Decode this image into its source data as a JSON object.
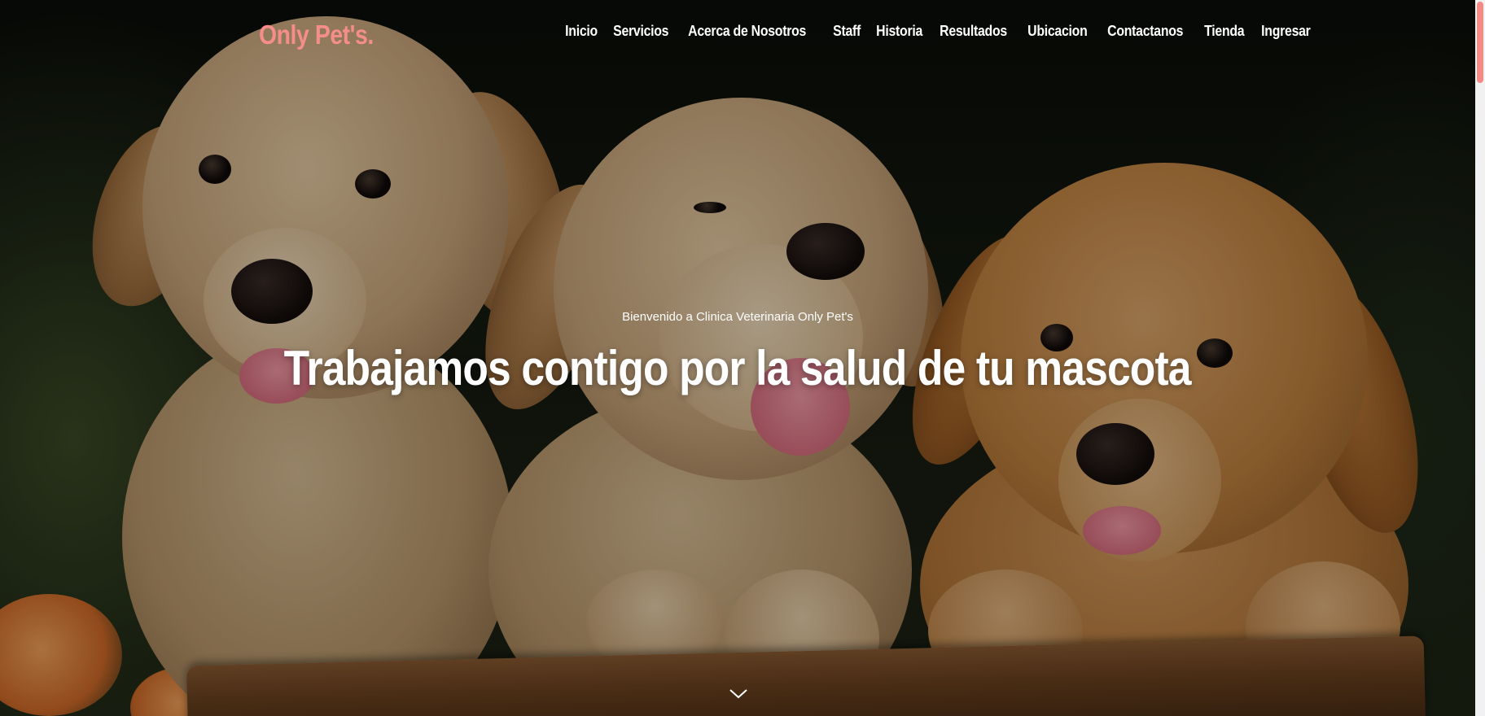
{
  "header": {
    "brand": "Only Pet's.",
    "nav": [
      {
        "label": "Inicio"
      },
      {
        "label": "Servicios"
      },
      {
        "label": "Acerca de Nosotros"
      },
      {
        "label": "Staff"
      },
      {
        "label": "Historia"
      },
      {
        "label": "Resultados"
      },
      {
        "label": "Ubicacion"
      },
      {
        "label": "Contactanos"
      },
      {
        "label": "Tienda"
      },
      {
        "label": "Ingresar"
      }
    ]
  },
  "hero": {
    "welcome": "Bienvenido a Clinica Veterinaria Only Pet's",
    "headline": "Trabajamos contigo por la salud de tu mascota",
    "scroll_icon": "chevron-down-icon",
    "image": "three golden retriever puppies on wooden crate"
  },
  "colors": {
    "brand": "#f58e88",
    "text": "#ffffff",
    "scroll_thumb": "#f28a86"
  }
}
